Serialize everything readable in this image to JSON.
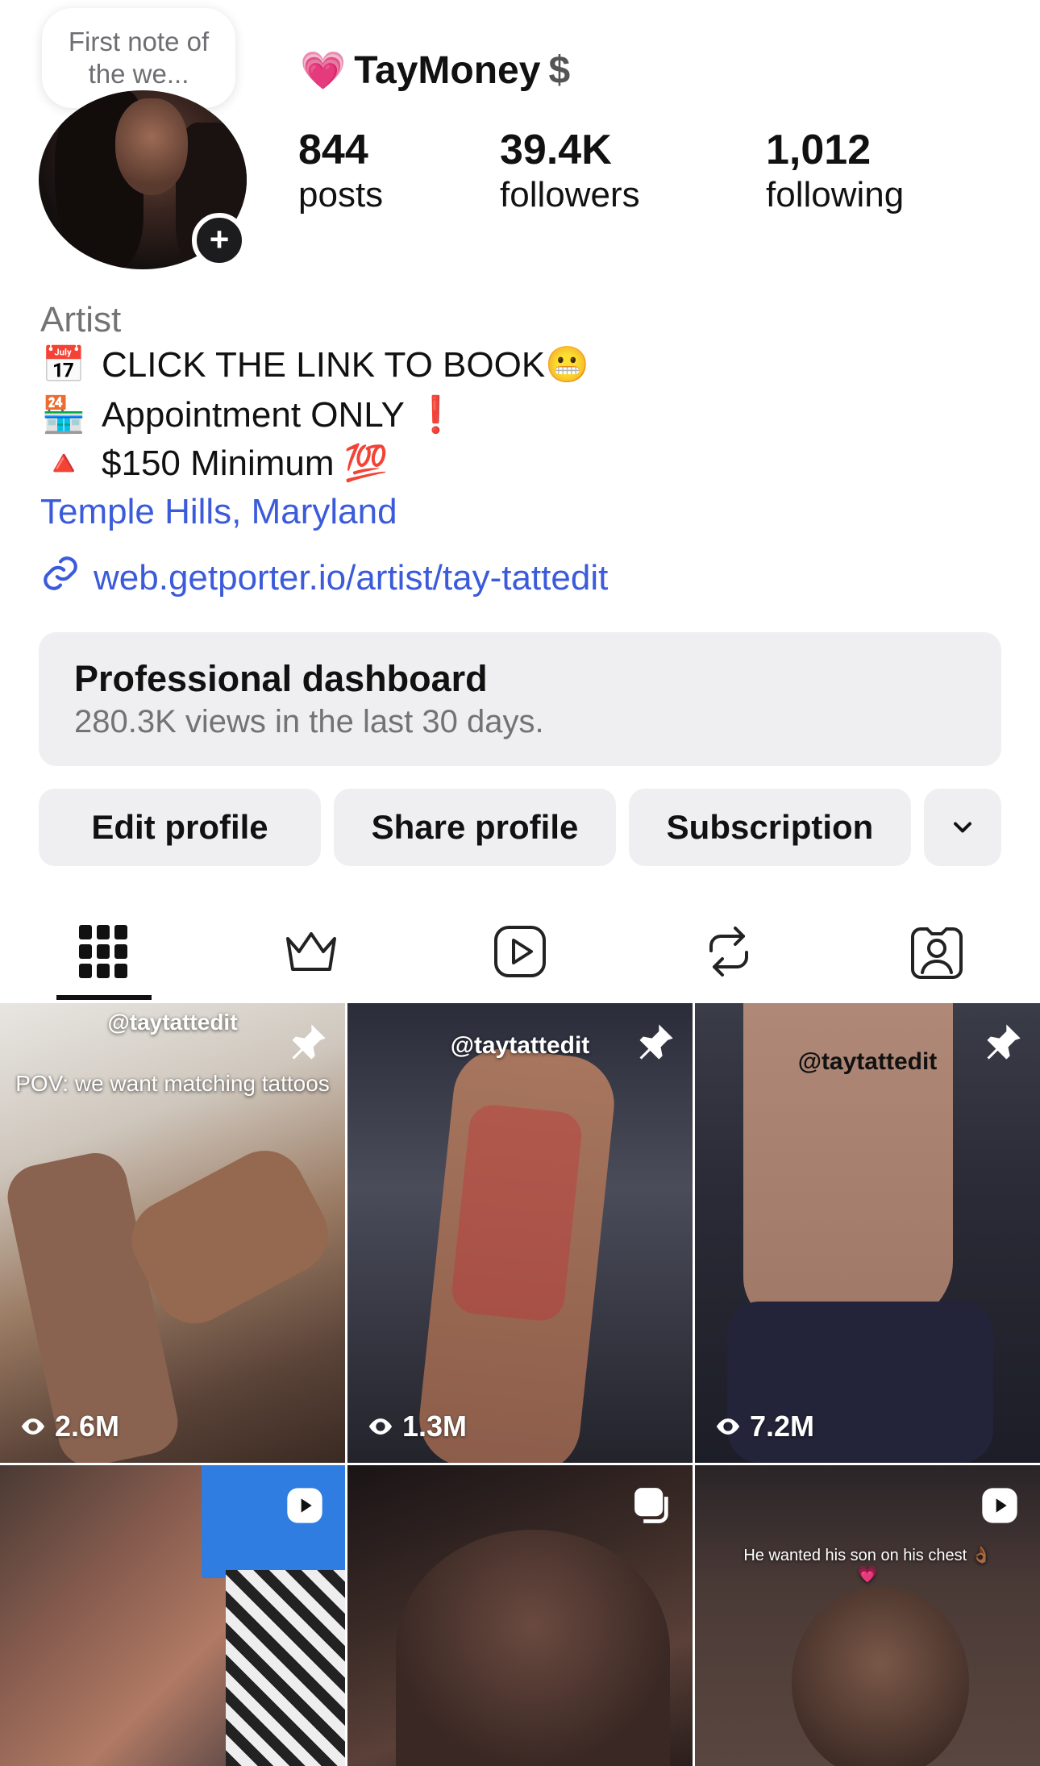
{
  "note": {
    "text": "First note of the we..."
  },
  "profile": {
    "username": "TayMoney",
    "posts_count": "844",
    "posts_label": "posts",
    "followers_count": "39.4K",
    "followers_label": "followers",
    "following_count": "1,012",
    "following_label": "following"
  },
  "bio": {
    "category": "Artist",
    "lines": [
      {
        "emoji": "📅",
        "text": "CLICK THE LINK TO BOOK😬"
      },
      {
        "emoji": "🏪",
        "text": "Appointment ONLY ❗"
      },
      {
        "emoji": "🔺",
        "text": "$150 Minimum 💯"
      }
    ],
    "location": "Temple Hills, Maryland",
    "link": "web.getporter.io/artist/tay-tattedit"
  },
  "dashboard": {
    "title": "Professional dashboard",
    "subtitle": "280.3K views in the last 30 days."
  },
  "actions": {
    "edit": "Edit profile",
    "share": "Share profile",
    "subscription": "Subscription"
  },
  "tabs": [
    "grid",
    "subscriptions",
    "reels",
    "reposts",
    "tagged"
  ],
  "grid": [
    {
      "handle": "@taytattedit",
      "caption": "POV: we want matching tattoos",
      "views": "2.6M",
      "pinned": true
    },
    {
      "handle": "@taytattedit",
      "caption": "",
      "views": "1.3M",
      "pinned": true
    },
    {
      "handle": "@taytattedit",
      "caption": "",
      "views": "7.2M",
      "pinned": true
    },
    {
      "handle": "",
      "caption": "",
      "views": "",
      "type": "reel"
    },
    {
      "handle": "",
      "caption": "",
      "views": "",
      "type": "carousel"
    },
    {
      "handle": "",
      "caption": "He wanted his son on his chest 👌🏾💗",
      "views": "",
      "type": "reel"
    }
  ],
  "colors": {
    "link": "#3b5bdb",
    "muted": "#737373",
    "button_bg": "#efeff1"
  }
}
